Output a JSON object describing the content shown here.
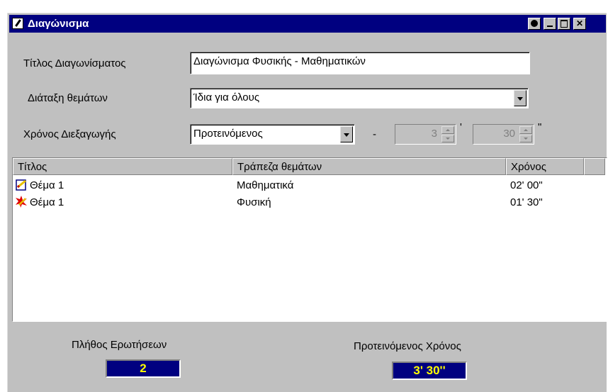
{
  "window": {
    "title": "Διαγώνισμα"
  },
  "form": {
    "title_label": "Τίτλος Διαγωνίσματος",
    "title_value": "Διαγώνισμα Φυσικής - Μαθηματικών",
    "order_label": "Διάταξη θεμάτων",
    "order_value": "Ίδια για όλους",
    "duration_label": "Χρόνος Διεξαγωγής",
    "duration_value": "Προτεινόμενος",
    "dash": "-",
    "minutes_value": "3",
    "minutes_unit": "'",
    "seconds_value": "30",
    "seconds_unit": "\""
  },
  "table": {
    "columns": [
      "Τίτλος",
      "Τράπεζα θεμάτων",
      "Χρόνος"
    ],
    "rows": [
      {
        "icon": "pencil-note-icon",
        "title": "Θέμα 1",
        "bank": "Μαθηματικά",
        "time": "02' 00\""
      },
      {
        "icon": "red-burst-icon",
        "title": "Θέμα 1",
        "bank": "Φυσική",
        "time": "01' 30\""
      }
    ]
  },
  "status": {
    "count_label": "Πλήθος Ερωτήσεων",
    "count_value": "2",
    "time_label": "Προτεινόμενος Χρόνος",
    "time_value": "3' 30''"
  },
  "colors": {
    "titlebar": "#000080",
    "lcd_text": "#ffff00",
    "face": "#c0c0c0"
  }
}
